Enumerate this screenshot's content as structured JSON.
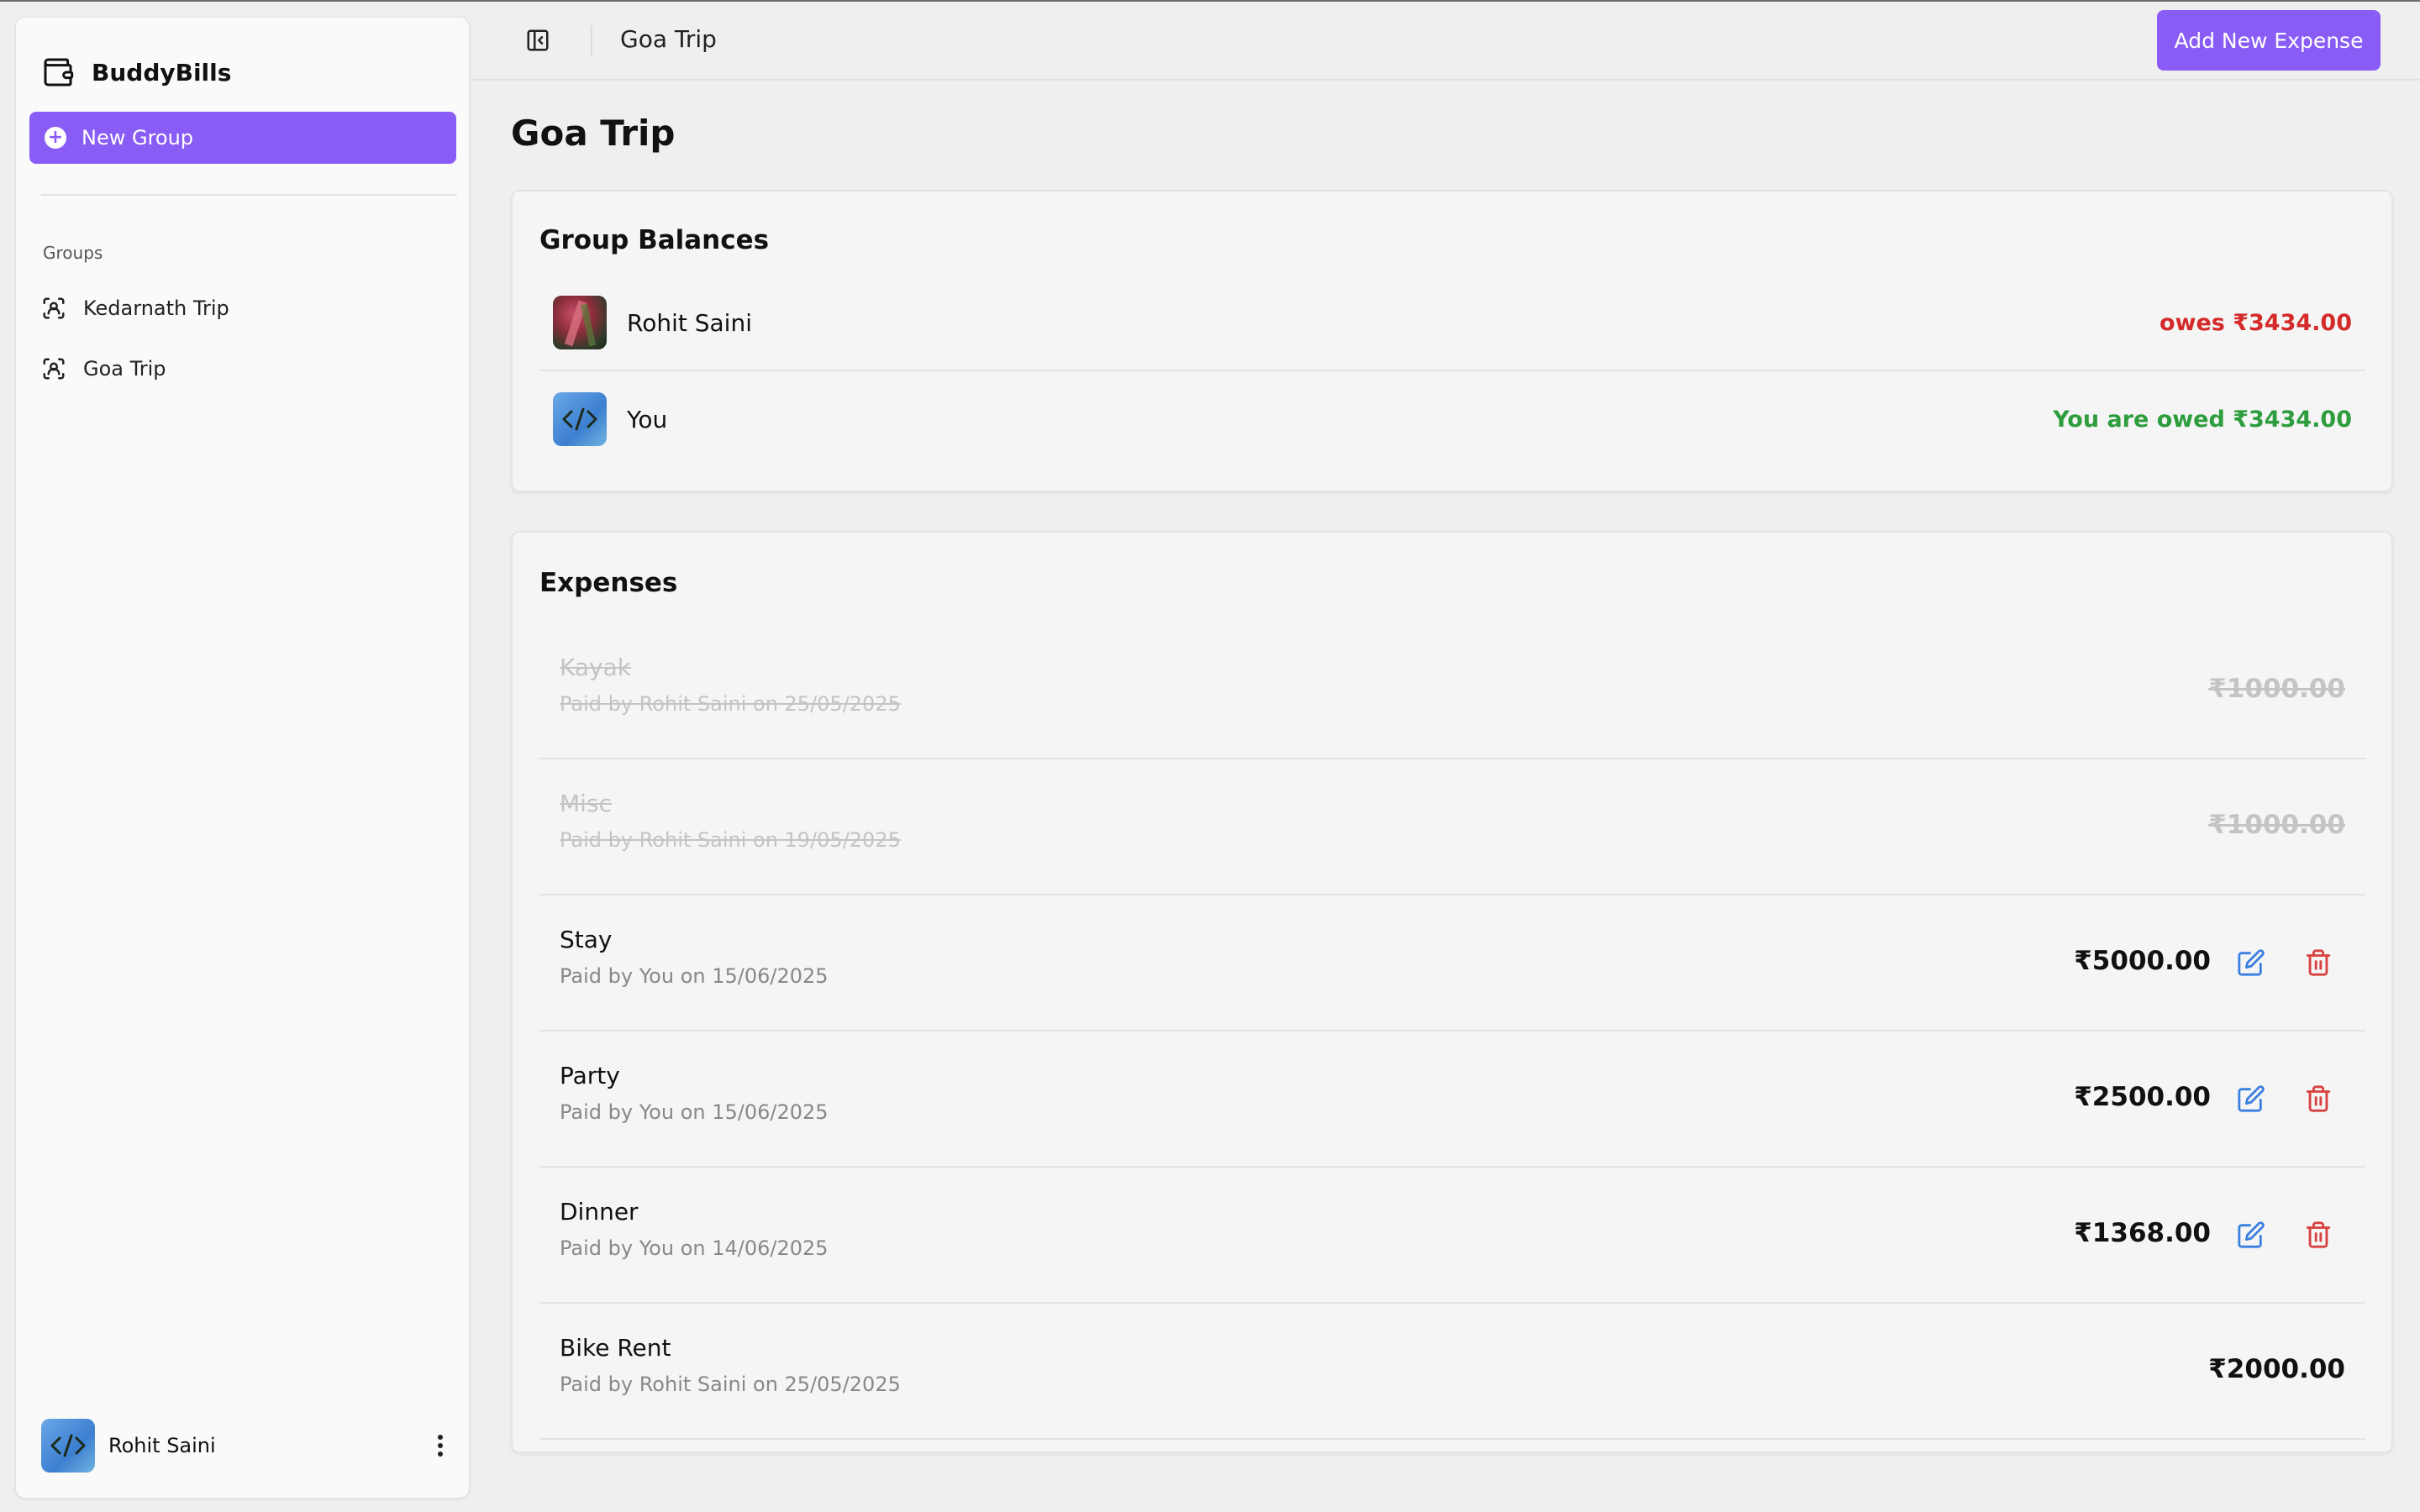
{
  "app": {
    "name": "BuddyBills"
  },
  "sidebar": {
    "new_group_label": "New Group",
    "groups_heading": "Groups",
    "groups": [
      {
        "label": "Kedarnath Trip"
      },
      {
        "label": "Goa Trip"
      }
    ],
    "user": {
      "name": "Rohit Saini"
    }
  },
  "topbar": {
    "breadcrumb": "Goa Trip",
    "add_expense_label": "Add New Expense"
  },
  "main": {
    "title": "Goa Trip",
    "balances": {
      "title": "Group Balances",
      "rows": [
        {
          "name": "Rohit Saini",
          "status": "owes ₹3434.00",
          "status_color": "#d42a2a"
        },
        {
          "name": "You",
          "status": "You are owed ₹3434.00",
          "status_color": "#2e9d3e"
        }
      ]
    },
    "expenses": {
      "title": "Expenses",
      "rows": [
        {
          "name": "Kayak",
          "meta": "Paid by Rohit Saini on 25/05/2025",
          "amount": "₹1000.00",
          "settled": true
        },
        {
          "name": "Misc",
          "meta": "Paid by Rohit Saini on 19/05/2025",
          "amount": "₹1000.00",
          "settled": true
        },
        {
          "name": "Stay",
          "meta": "Paid by You on 15/06/2025",
          "amount": "₹5000.00",
          "settled": false
        },
        {
          "name": "Party",
          "meta": "Paid by You on 15/06/2025",
          "amount": "₹2500.00",
          "settled": false
        },
        {
          "name": "Dinner",
          "meta": "Paid by You on 14/06/2025",
          "amount": "₹1368.00",
          "settled": false
        },
        {
          "name": "Bike Rent",
          "meta": "Paid by Rohit Saini on 25/05/2025",
          "amount": "₹2000.00",
          "settled": false
        }
      ]
    }
  },
  "colors": {
    "accent": "#8a5cf6",
    "owes": "#d42a2a",
    "owed": "#2e9d3e",
    "edit": "#3b7fe0",
    "delete": "#d94040"
  },
  "icons": {
    "brand": "wallet-icon",
    "new_group": "plus-circle-icon",
    "group": "scan-icon",
    "toggle": "panel-left-icon",
    "menu": "kebab-icon",
    "edit": "edit-icon",
    "delete": "trash-icon"
  }
}
